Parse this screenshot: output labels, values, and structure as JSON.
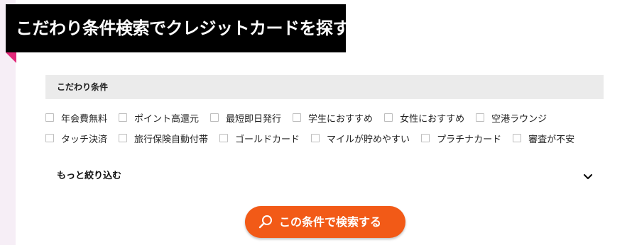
{
  "heading": {
    "title": "こだわり条件検索でクレジットカードを探す"
  },
  "filters": {
    "header": "こだわり条件",
    "row1": [
      "年会費無料",
      "ポイント高還元",
      "最短即日発行",
      "学生におすすめ",
      "女性におすすめ",
      "空港ラウンジ"
    ],
    "row2": [
      "タッチ決済",
      "旅行保険自動付帯",
      "ゴールドカード",
      "マイルが貯めやすい",
      "プラチナカード",
      "審査が不安"
    ]
  },
  "more": {
    "label": "もっと絞り込む",
    "icon": "chevron-down-icon"
  },
  "search_button": {
    "label": "この条件で検索する",
    "icon": "search-icon"
  },
  "colors": {
    "heading_bg": "#000000",
    "accent_pink": "#e2287a",
    "button_orange": "#f25a17",
    "filter_header_bg": "#ebebeb"
  }
}
